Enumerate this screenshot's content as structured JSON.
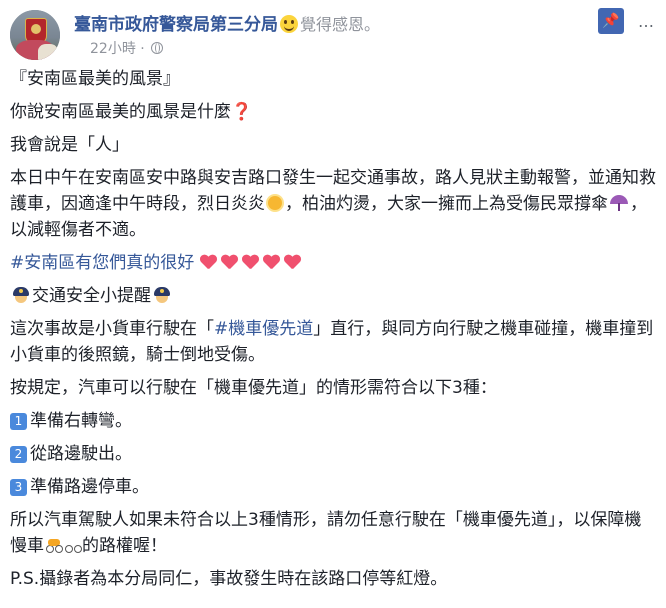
{
  "header": {
    "page_name": "臺南市政府警察局第三分局",
    "feeling": "覺得感恩。",
    "time": "22小時",
    "separator": "·"
  },
  "icons": {
    "smile": "smiling-face-icon",
    "globe": "globe-icon",
    "pin": "pin-icon",
    "more": "ellipsis-icon",
    "question": "red-question-mark-icon",
    "sun": "sun-icon",
    "umbrella": "umbrella-icon",
    "heart": "red-heart-icon",
    "police": "police-officer-icon",
    "scooter": "motor-scooter-icon",
    "bicycle": "bicycle-icon"
  },
  "colors": {
    "link": "#365899",
    "pin_button": "#4267b2",
    "number_badge": "#4a89dc",
    "heart": "#f0506e"
  },
  "post": {
    "line1": "『安南區最美的風景』",
    "line2": "你說安南區最美的風景是什麼",
    "line2_mark": "❓",
    "line3": "我會說是「人」",
    "para1_a": "本日中午在安南區安中路與安吉路口發生一起交通事故，路人見狀主動報警，並通知救護車，因適逢中午時段，烈日炎炎",
    "para1_b": "，柏油灼燙，大家一擁而上為受傷民眾撐傘",
    "para1_c": "，以減輕傷者不適。",
    "hashtag": "#安南區有您們真的很好",
    "tips_title": "交通安全小提醒",
    "para2_a": "這次事故是小貨車行駛在「",
    "para2_hashtag": "#機車優先道",
    "para2_b": "」直行，與同方向行駛之機車碰撞，機車撞到小貨車的後照鏡，騎士倒地受傷。",
    "para3": "按規定，汽車可以行駛在「機車優先道」的情形需符合以下3種：",
    "rules": [
      {
        "num": "1",
        "text": "準備右轉彎。"
      },
      {
        "num": "2",
        "text": "從路邊駛出。"
      },
      {
        "num": "3",
        "text": "準備路邊停車。"
      }
    ],
    "para4_a": "所以汽車駕駛人如果未符合以上3種情形，請勿任意行駛在「機車優先道」，以保障機慢車",
    "para4_b": "的路權喔！",
    "ps": "P.S.攝錄者為本分局同仁，事故發生時在該路口停等紅燈。"
  }
}
